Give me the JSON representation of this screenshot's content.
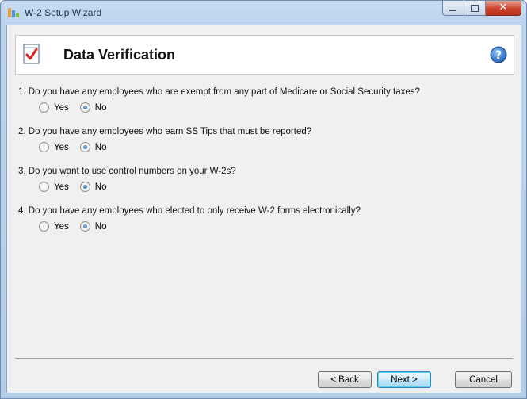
{
  "window": {
    "title": "W-2 Setup Wizard"
  },
  "header": {
    "title": "Data Verification"
  },
  "questions": [
    {
      "text": "1. Do you have any employees who are exempt from any part of Medicare or Social Security taxes?",
      "yes_label": "Yes",
      "no_label": "No",
      "selected": "No"
    },
    {
      "text": "2. Do you have any employees who earn SS Tips that must be reported?",
      "yes_label": "Yes",
      "no_label": "No",
      "selected": "No"
    },
    {
      "text": "3. Do you want to use control numbers on your W-2s?",
      "yes_label": "Yes",
      "no_label": "No",
      "selected": "No"
    },
    {
      "text": "4. Do you have any employees who elected to only receive W-2 forms electronically?",
      "yes_label": "Yes",
      "no_label": "No",
      "selected": "No"
    }
  ],
  "buttons": {
    "back": "< Back",
    "next": "Next >",
    "cancel": "Cancel"
  },
  "icons": {
    "app": "w2-app-icon",
    "header": "checklist-icon",
    "help": "help-icon"
  },
  "colors": {
    "accent": "#1d4f86",
    "help_blue": "#1e6ec8",
    "check_red": "#d7261e"
  }
}
